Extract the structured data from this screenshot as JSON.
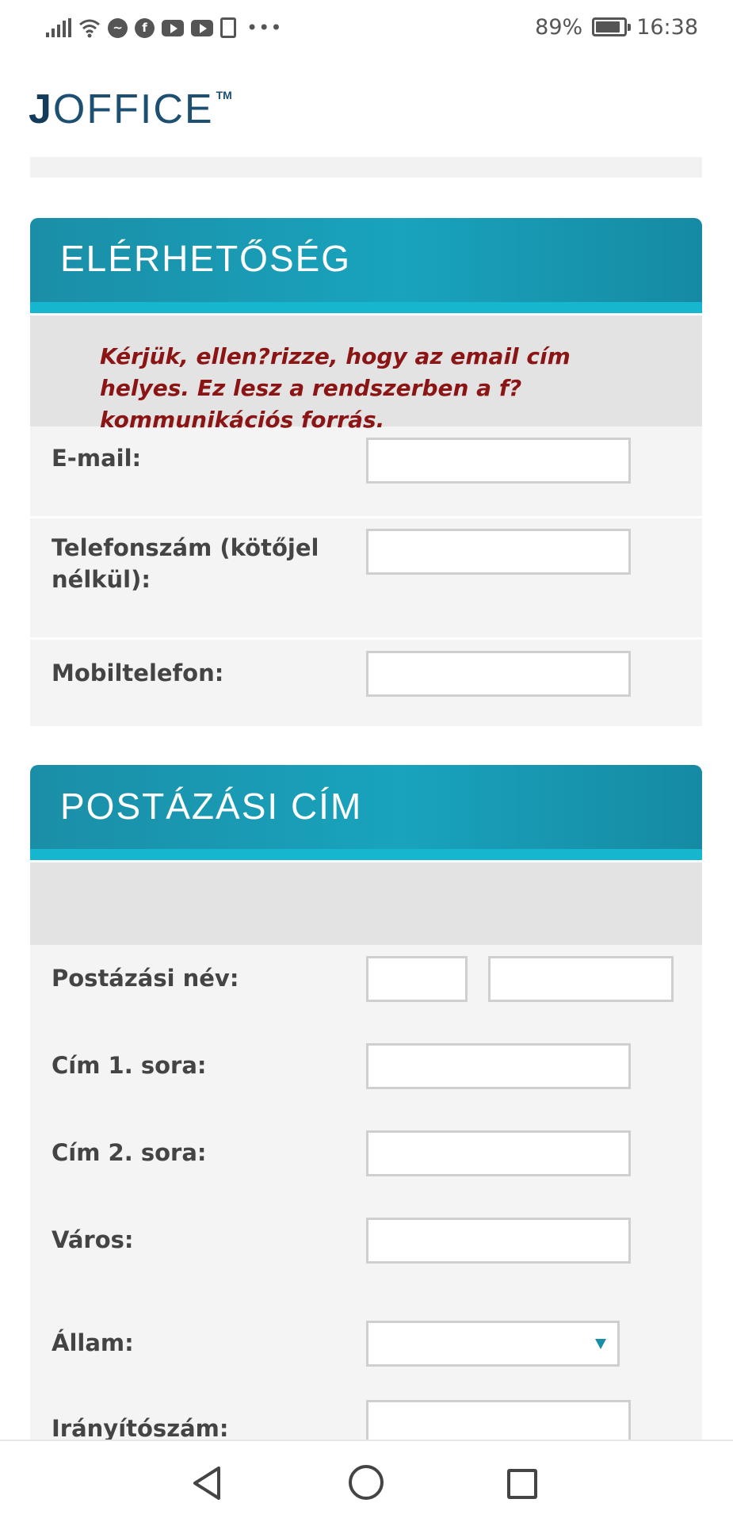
{
  "status_bar": {
    "battery": "89%",
    "battery_level": 0.89,
    "time": "16:38",
    "icons": [
      "signal-icon",
      "wifi-icon",
      "messenger-icon",
      "facebook-icon",
      "youtube-icon",
      "youtube-icon",
      "sim-icon",
      "more-dots-icon"
    ]
  },
  "logo": {
    "first": "J",
    "rest": "OFFICE",
    "tm": "TM"
  },
  "contact": {
    "title": "ELÉRHETŐSÉG",
    "notice": "Kérjük, ellen?rizze, hogy az email cím helyes. Ez lesz a rendszerben a f? kommunikációs forrás.",
    "email_label": "E-mail:",
    "phone_label": "Telefonszám (kötőjel nélkül):",
    "mobile_label": "Mobiltelefon:"
  },
  "postal": {
    "title": "POSTÁZÁSI CÍM",
    "name_label": "Postázási név:",
    "address1_label": "Cím 1. sora:",
    "address2_label": "Cím 2. sora:",
    "city_label": "Város:",
    "state_label": "Állam:",
    "zip_label": "Irányítószám:"
  },
  "colors": {
    "header_gradient_start": "#1b8ea7",
    "header_gradient_end": "#168aa3",
    "header_stripe": "#16b6cf",
    "notice_text": "#8b1414",
    "logo": "#1c4f72"
  }
}
